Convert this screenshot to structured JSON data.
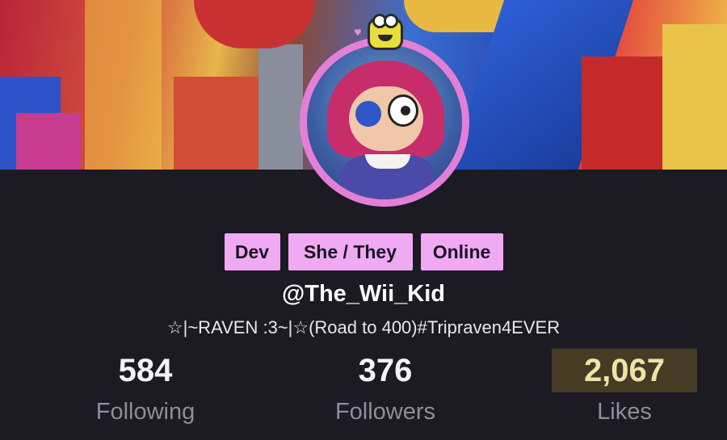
{
  "profile": {
    "tags": [
      "Dev",
      "She / They",
      "Online"
    ],
    "username": "@The_Wii_Kid",
    "bio": "☆|~RAVEN :3~|☆(Road to 400)#Tripraven4EVER"
  },
  "stats": {
    "following": {
      "value": "584",
      "label": "Following"
    },
    "followers": {
      "value": "376",
      "label": "Followers"
    },
    "likes": {
      "value": "2,067",
      "label": "Likes"
    }
  },
  "icons": {
    "avatar_badge": "frog-icon"
  },
  "colors": {
    "background": "#1c1b24",
    "tag_background": "#efaaf3",
    "avatar_ring": "#e37fd6",
    "likes_highlight": "#efe3a6"
  }
}
